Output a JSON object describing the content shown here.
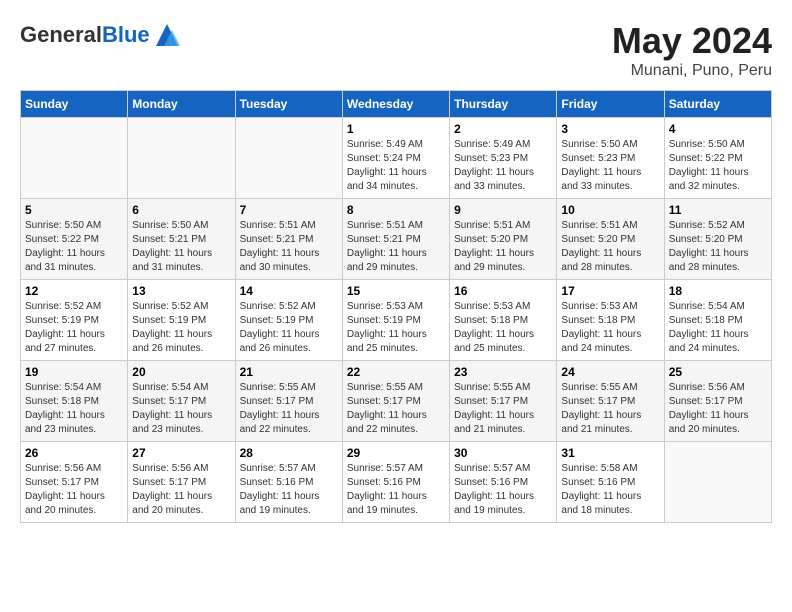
{
  "logo": {
    "general": "General",
    "blue": "Blue"
  },
  "title": {
    "month": "May 2024",
    "location": "Munani, Puno, Peru"
  },
  "weekdays": [
    "Sunday",
    "Monday",
    "Tuesday",
    "Wednesday",
    "Thursday",
    "Friday",
    "Saturday"
  ],
  "weeks": [
    [
      {
        "day": "",
        "sunrise": "",
        "sunset": "",
        "daylight": ""
      },
      {
        "day": "",
        "sunrise": "",
        "sunset": "",
        "daylight": ""
      },
      {
        "day": "",
        "sunrise": "",
        "sunset": "",
        "daylight": ""
      },
      {
        "day": "1",
        "sunrise": "Sunrise: 5:49 AM",
        "sunset": "Sunset: 5:24 PM",
        "daylight": "Daylight: 11 hours and 34 minutes."
      },
      {
        "day": "2",
        "sunrise": "Sunrise: 5:49 AM",
        "sunset": "Sunset: 5:23 PM",
        "daylight": "Daylight: 11 hours and 33 minutes."
      },
      {
        "day": "3",
        "sunrise": "Sunrise: 5:50 AM",
        "sunset": "Sunset: 5:23 PM",
        "daylight": "Daylight: 11 hours and 33 minutes."
      },
      {
        "day": "4",
        "sunrise": "Sunrise: 5:50 AM",
        "sunset": "Sunset: 5:22 PM",
        "daylight": "Daylight: 11 hours and 32 minutes."
      }
    ],
    [
      {
        "day": "5",
        "sunrise": "Sunrise: 5:50 AM",
        "sunset": "Sunset: 5:22 PM",
        "daylight": "Daylight: 11 hours and 31 minutes."
      },
      {
        "day": "6",
        "sunrise": "Sunrise: 5:50 AM",
        "sunset": "Sunset: 5:21 PM",
        "daylight": "Daylight: 11 hours and 31 minutes."
      },
      {
        "day": "7",
        "sunrise": "Sunrise: 5:51 AM",
        "sunset": "Sunset: 5:21 PM",
        "daylight": "Daylight: 11 hours and 30 minutes."
      },
      {
        "day": "8",
        "sunrise": "Sunrise: 5:51 AM",
        "sunset": "Sunset: 5:21 PM",
        "daylight": "Daylight: 11 hours and 29 minutes."
      },
      {
        "day": "9",
        "sunrise": "Sunrise: 5:51 AM",
        "sunset": "Sunset: 5:20 PM",
        "daylight": "Daylight: 11 hours and 29 minutes."
      },
      {
        "day": "10",
        "sunrise": "Sunrise: 5:51 AM",
        "sunset": "Sunset: 5:20 PM",
        "daylight": "Daylight: 11 hours and 28 minutes."
      },
      {
        "day": "11",
        "sunrise": "Sunrise: 5:52 AM",
        "sunset": "Sunset: 5:20 PM",
        "daylight": "Daylight: 11 hours and 28 minutes."
      }
    ],
    [
      {
        "day": "12",
        "sunrise": "Sunrise: 5:52 AM",
        "sunset": "Sunset: 5:19 PM",
        "daylight": "Daylight: 11 hours and 27 minutes."
      },
      {
        "day": "13",
        "sunrise": "Sunrise: 5:52 AM",
        "sunset": "Sunset: 5:19 PM",
        "daylight": "Daylight: 11 hours and 26 minutes."
      },
      {
        "day": "14",
        "sunrise": "Sunrise: 5:52 AM",
        "sunset": "Sunset: 5:19 PM",
        "daylight": "Daylight: 11 hours and 26 minutes."
      },
      {
        "day": "15",
        "sunrise": "Sunrise: 5:53 AM",
        "sunset": "Sunset: 5:19 PM",
        "daylight": "Daylight: 11 hours and 25 minutes."
      },
      {
        "day": "16",
        "sunrise": "Sunrise: 5:53 AM",
        "sunset": "Sunset: 5:18 PM",
        "daylight": "Daylight: 11 hours and 25 minutes."
      },
      {
        "day": "17",
        "sunrise": "Sunrise: 5:53 AM",
        "sunset": "Sunset: 5:18 PM",
        "daylight": "Daylight: 11 hours and 24 minutes."
      },
      {
        "day": "18",
        "sunrise": "Sunrise: 5:54 AM",
        "sunset": "Sunset: 5:18 PM",
        "daylight": "Daylight: 11 hours and 24 minutes."
      }
    ],
    [
      {
        "day": "19",
        "sunrise": "Sunrise: 5:54 AM",
        "sunset": "Sunset: 5:18 PM",
        "daylight": "Daylight: 11 hours and 23 minutes."
      },
      {
        "day": "20",
        "sunrise": "Sunrise: 5:54 AM",
        "sunset": "Sunset: 5:17 PM",
        "daylight": "Daylight: 11 hours and 23 minutes."
      },
      {
        "day": "21",
        "sunrise": "Sunrise: 5:55 AM",
        "sunset": "Sunset: 5:17 PM",
        "daylight": "Daylight: 11 hours and 22 minutes."
      },
      {
        "day": "22",
        "sunrise": "Sunrise: 5:55 AM",
        "sunset": "Sunset: 5:17 PM",
        "daylight": "Daylight: 11 hours and 22 minutes."
      },
      {
        "day": "23",
        "sunrise": "Sunrise: 5:55 AM",
        "sunset": "Sunset: 5:17 PM",
        "daylight": "Daylight: 11 hours and 21 minutes."
      },
      {
        "day": "24",
        "sunrise": "Sunrise: 5:55 AM",
        "sunset": "Sunset: 5:17 PM",
        "daylight": "Daylight: 11 hours and 21 minutes."
      },
      {
        "day": "25",
        "sunrise": "Sunrise: 5:56 AM",
        "sunset": "Sunset: 5:17 PM",
        "daylight": "Daylight: 11 hours and 20 minutes."
      }
    ],
    [
      {
        "day": "26",
        "sunrise": "Sunrise: 5:56 AM",
        "sunset": "Sunset: 5:17 PM",
        "daylight": "Daylight: 11 hours and 20 minutes."
      },
      {
        "day": "27",
        "sunrise": "Sunrise: 5:56 AM",
        "sunset": "Sunset: 5:17 PM",
        "daylight": "Daylight: 11 hours and 20 minutes."
      },
      {
        "day": "28",
        "sunrise": "Sunrise: 5:57 AM",
        "sunset": "Sunset: 5:16 PM",
        "daylight": "Daylight: 11 hours and 19 minutes."
      },
      {
        "day": "29",
        "sunrise": "Sunrise: 5:57 AM",
        "sunset": "Sunset: 5:16 PM",
        "daylight": "Daylight: 11 hours and 19 minutes."
      },
      {
        "day": "30",
        "sunrise": "Sunrise: 5:57 AM",
        "sunset": "Sunset: 5:16 PM",
        "daylight": "Daylight: 11 hours and 19 minutes."
      },
      {
        "day": "31",
        "sunrise": "Sunrise: 5:58 AM",
        "sunset": "Sunset: 5:16 PM",
        "daylight": "Daylight: 11 hours and 18 minutes."
      },
      {
        "day": "",
        "sunrise": "",
        "sunset": "",
        "daylight": ""
      }
    ]
  ]
}
